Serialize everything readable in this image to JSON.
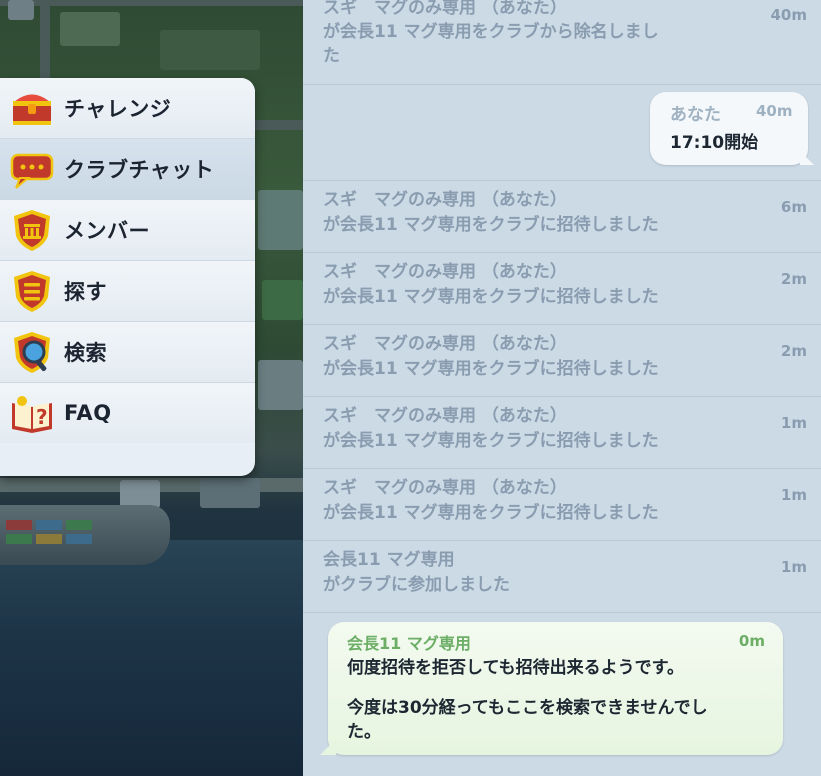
{
  "menu": {
    "items": [
      {
        "label": "チャレンジ",
        "icon": "treasure-chest-icon"
      },
      {
        "label": "クラブチャット",
        "icon": "chat-bubble-icon"
      },
      {
        "label": "メンバー",
        "icon": "club-shield-icon"
      },
      {
        "label": "探す",
        "icon": "list-shield-icon"
      },
      {
        "label": "検索",
        "icon": "magnifier-icon"
      },
      {
        "label": "FAQ",
        "icon": "question-book-icon"
      }
    ],
    "active_index": 1
  },
  "chat": {
    "messages": [
      {
        "type": "system",
        "line1": "スギ　マグのみ専用 （あなた）",
        "line2": "が会長11 マグ専用をクラブから除名しまし",
        "line3": "た",
        "time": "40m"
      },
      {
        "type": "self",
        "name": "あなた",
        "time": "40m",
        "text": "17:10開始"
      },
      {
        "type": "system",
        "line1": "スギ　マグのみ専用 （あなた）",
        "line2": "が会長11 マグ専用をクラブに招待しました",
        "time": "6m"
      },
      {
        "type": "system",
        "line1": "スギ　マグのみ専用 （あなた）",
        "line2": "が会長11 マグ専用をクラブに招待しました",
        "time": "2m"
      },
      {
        "type": "system",
        "line1": "スギ　マグのみ専用 （あなた）",
        "line2": "が会長11 マグ専用をクラブに招待しました",
        "time": "2m"
      },
      {
        "type": "system",
        "line1": "スギ　マグのみ専用 （あなた）",
        "line2": "が会長11 マグ専用をクラブに招待しました",
        "time": "1m"
      },
      {
        "type": "system",
        "line1": "スギ　マグのみ専用 （あなた）",
        "line2": "が会長11 マグ専用をクラブに招待しました",
        "time": "1m"
      },
      {
        "type": "system",
        "line1": "会長11 マグ専用",
        "line2": "がクラブに参加しました",
        "time": "1m"
      },
      {
        "type": "other",
        "name": "会長11 マグ専用",
        "time": "0m",
        "text1": "何度招待を拒否しても招待出来るようです。",
        "text2a": "今度は30分経ってもここを検索できませんでし",
        "text2b": "た。"
      }
    ]
  },
  "colors": {
    "chat_bg": "#ccdae6",
    "system_text": "#8a9db0",
    "other_name": "#6cae66",
    "menu_bg": "#e7eef5"
  }
}
